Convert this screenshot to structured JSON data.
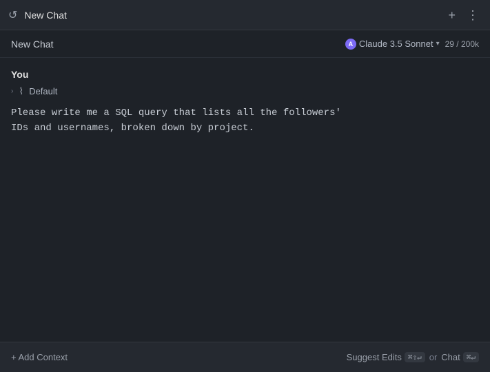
{
  "titleBar": {
    "icon": "↺",
    "title": "New Chat",
    "addButton": "+",
    "moreButton": "⋮"
  },
  "subHeader": {
    "title": "New Chat",
    "model": {
      "icon": "A",
      "name": "Claude 3.5 Sonnet",
      "chevron": "▾"
    },
    "tokens": "29 / 200k"
  },
  "message": {
    "author": "You",
    "toolCall": {
      "label": "Default"
    },
    "text": "Please write me a SQL query that lists all the followers'\nIDs and usernames, broken down by project."
  },
  "bottomBar": {
    "addContext": "+ Add Context",
    "suggestEdits": "Suggest Edits",
    "suggestShortcut": "⌘⇧↵",
    "or": "or",
    "chat": "Chat",
    "chatShortcut": "⌘↵"
  }
}
